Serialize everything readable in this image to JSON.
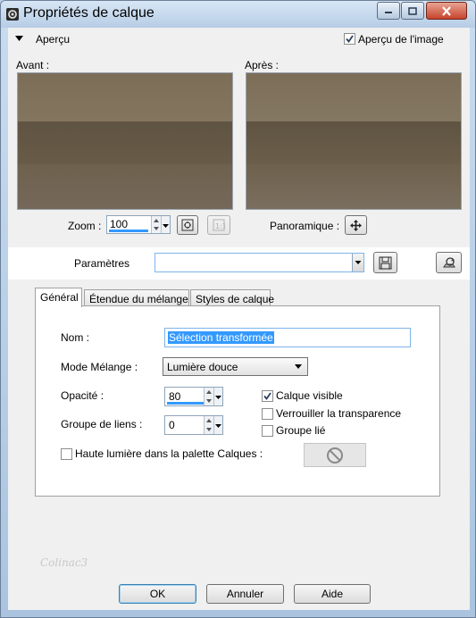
{
  "window": {
    "title": "Propriétés de calque",
    "controls": [
      "minimize",
      "maximize",
      "close"
    ]
  },
  "preview_section": {
    "label": "Aperçu",
    "show_preview_label": "Aperçu de l'image",
    "show_preview_checked": true,
    "before_label": "Avant :",
    "after_label": "Après :"
  },
  "zoom": {
    "label": "Zoom :",
    "value": "100",
    "pan_label": "Panoramique :"
  },
  "presets": {
    "label": "Paramètres",
    "value": ""
  },
  "tabs": [
    {
      "label": "Général",
      "active": true
    },
    {
      "label": "Étendue du mélange",
      "active": false
    },
    {
      "label": "Styles de calque",
      "active": false
    }
  ],
  "general": {
    "name_label": "Nom :",
    "name_value": "Sélection transformée",
    "blend_label": "Mode Mélange :",
    "blend_value": "Lumière douce",
    "opacity_label": "Opacité :",
    "opacity_value": "80",
    "group_label": "Groupe de liens :",
    "group_value": "0",
    "visible_label": "Calque visible",
    "visible_checked": true,
    "lock_label": "Verrouiller la transparence",
    "lock_checked": false,
    "linked_label": "Groupe lié",
    "linked_checked": false,
    "highlight_label": "Haute lumière dans la palette Calques :",
    "highlight_checked": false
  },
  "watermark": "Colinac3",
  "buttons": {
    "ok": "OK",
    "cancel": "Annuler",
    "help": "Aide"
  },
  "colors": {
    "preview_top": "#7a6c57",
    "preview_mid": "#5f5341",
    "preview_bottom": "#6c604d",
    "accent": "#3399ff"
  }
}
